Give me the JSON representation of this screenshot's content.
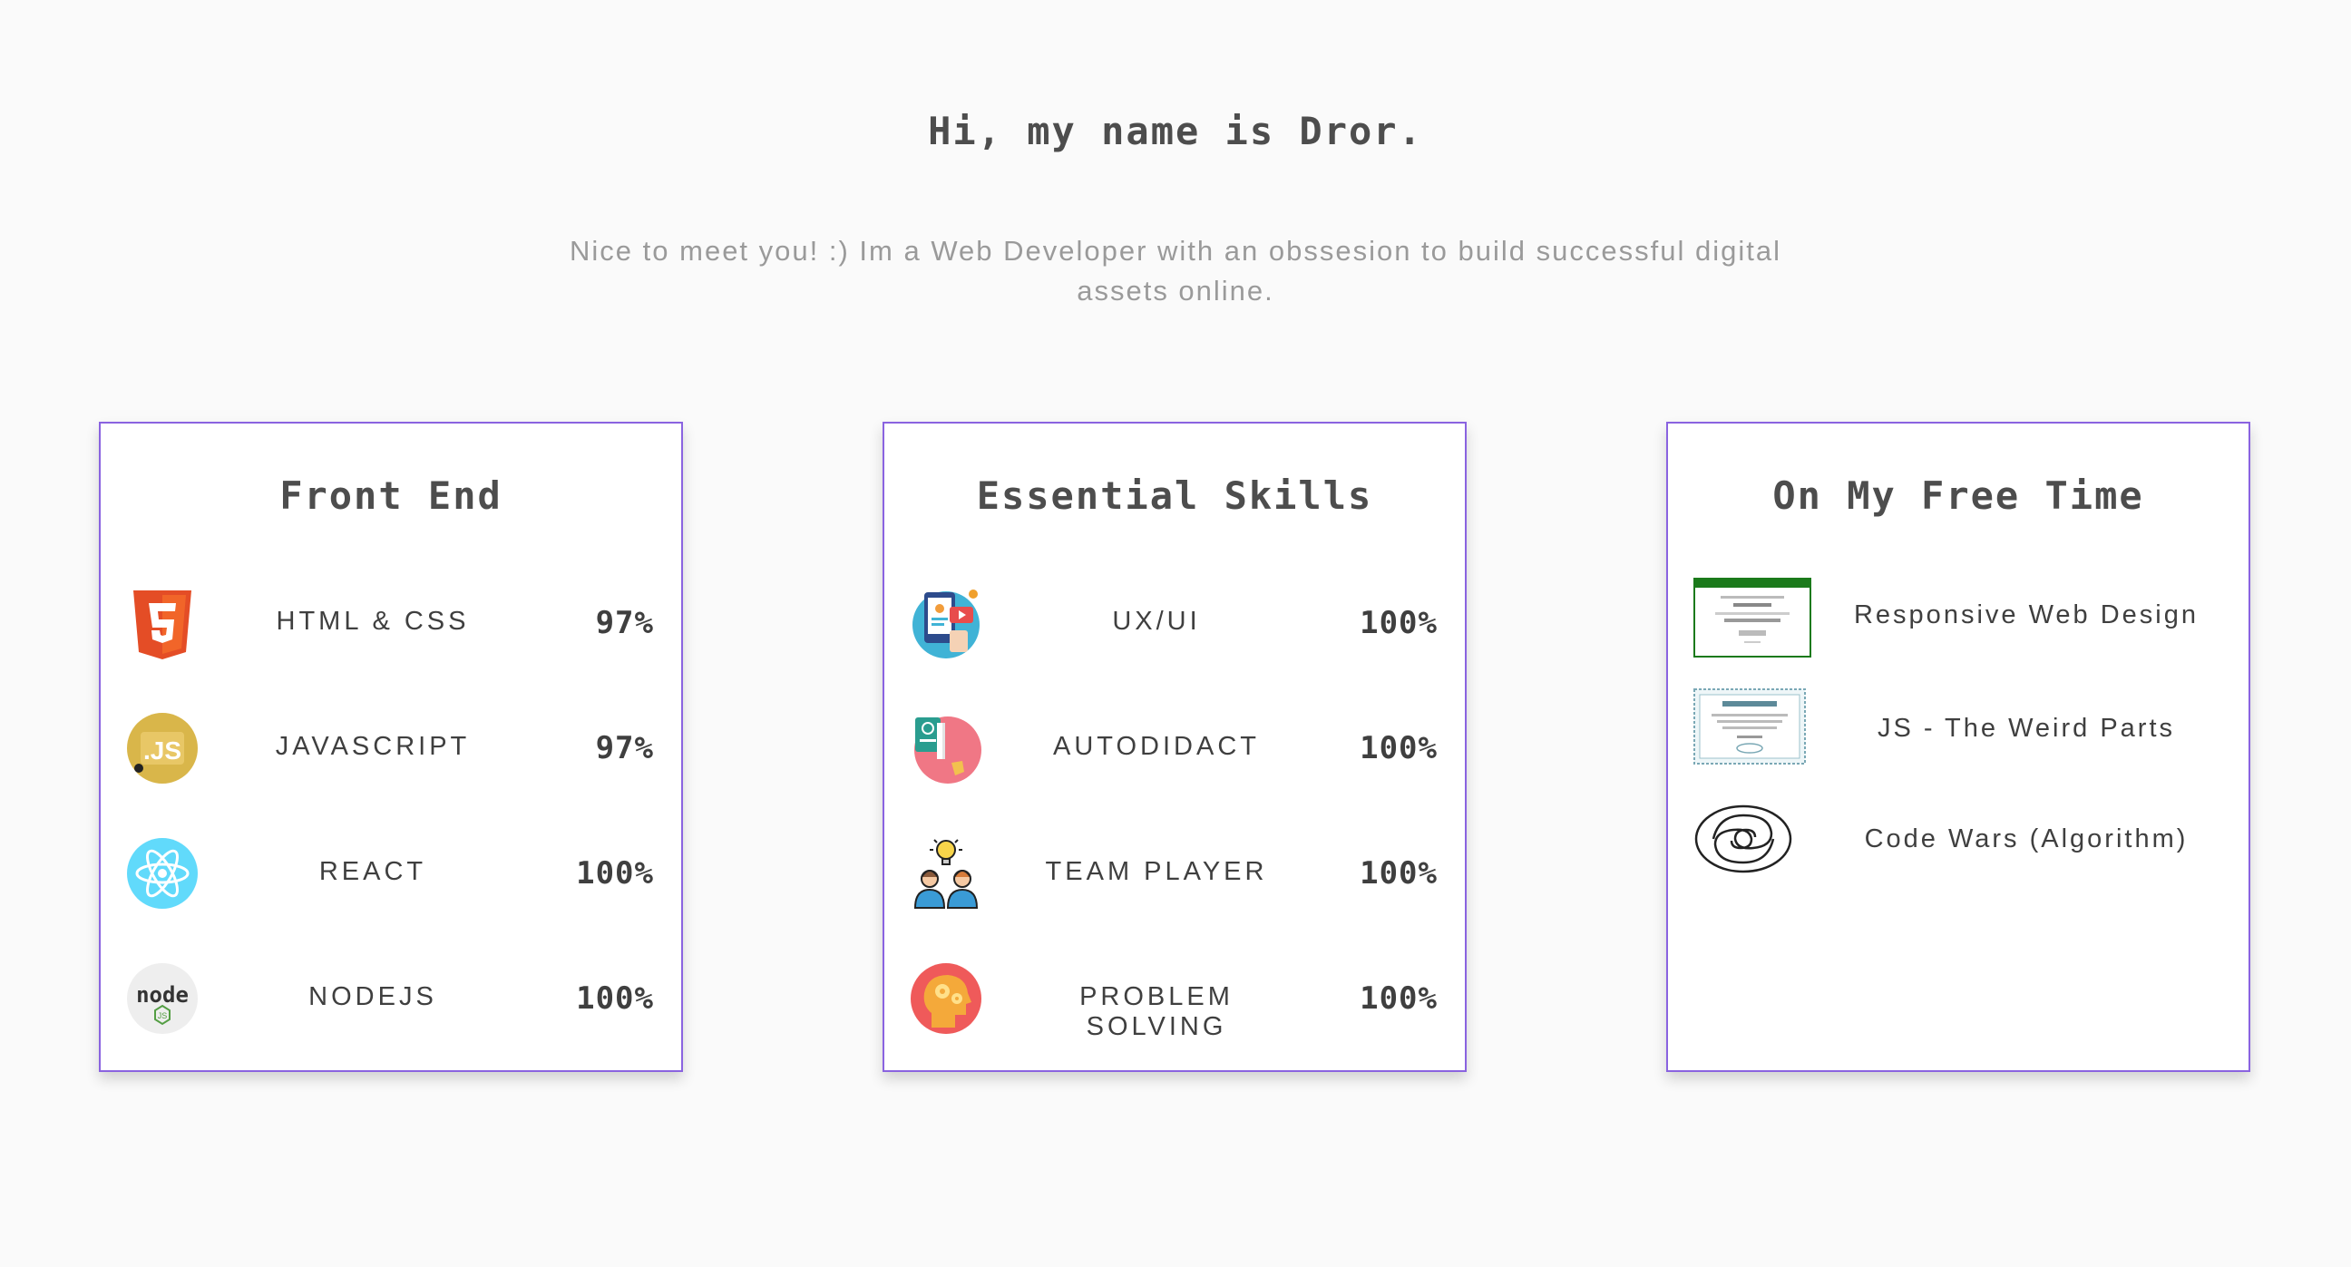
{
  "hero": {
    "title": "Hi, my name is Dror.",
    "subtitle": "Nice to meet you! :) Im a Web Developer with an obssesion to build successful digital assets online."
  },
  "cards": {
    "front_end": {
      "title": "Front End",
      "items": [
        {
          "label": "HTML & CSS",
          "percent": "97%",
          "icon": "html5-icon"
        },
        {
          "label": "JAVASCRIPT",
          "percent": "97%",
          "icon": "javascript-icon"
        },
        {
          "label": "REACT",
          "percent": "100%",
          "icon": "react-icon"
        },
        {
          "label": "NODEJS",
          "percent": "100%",
          "icon": "nodejs-icon"
        }
      ]
    },
    "essential": {
      "title": "Essential Skills",
      "items": [
        {
          "label": "UX/UI",
          "percent": "100%",
          "icon": "ux-ui-icon"
        },
        {
          "label": "AUTODIDACT",
          "percent": "100%",
          "icon": "autodidact-icon"
        },
        {
          "label": "TEAM PLAYER",
          "percent": "100%",
          "icon": "team-player-icon"
        },
        {
          "label": "PROBLEM SOLVING",
          "percent": "100%",
          "icon": "problem-solving-icon"
        }
      ]
    },
    "free_time": {
      "title": "On My Free Time",
      "items": [
        {
          "label": "Responsive Web Design",
          "icon": "certificate-thumbnail"
        },
        {
          "label": "JS - The Weird Parts",
          "icon": "certificate-thumbnail"
        },
        {
          "label": "Code Wars (Algorithm)",
          "icon": "codewars-logo-icon"
        }
      ]
    }
  },
  "colors": {
    "card_border": "#8a63e0",
    "background": "#fafafa",
    "html5": "#e44d26",
    "javascript": "#d9b64a",
    "react": "#61dafb",
    "node": "#539e43"
  }
}
